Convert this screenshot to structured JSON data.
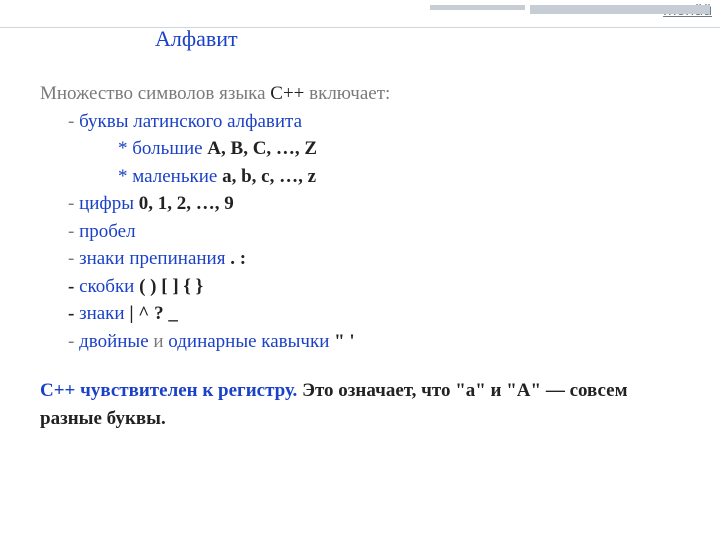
{
  "menu": "menüü",
  "title": "Алфавит",
  "intro_gray": "Множество символов языка ",
  "intro_cpp": "С++",
  "intro_after": " включает:",
  "line_latin": "буквы латинского алфавита",
  "line_big_prefix": "* большие",
  "letters_big": " A, B, C, …, Z",
  "line_small_prefix": "* маленькие",
  "letters_small": " a, b, c, …, z",
  "line_digits": "цифры",
  "digits": " 0, 1, 2, …, 9",
  "line_space": "пробел",
  "line_punct": "знаки препинания",
  "punct": "  .   :",
  "line_brackets": "скобки",
  "brackets": " (   )   [   ]   {   }",
  "line_signs": "знаки",
  "signs": "  |   ^   ?   _",
  "line_quotes_1": "двойные",
  "line_quotes_and": " и ",
  "line_quotes_2": "одинарные кавычки",
  "quotes": "  \"    '",
  "note_1": "C++ чувствителен к регистру.",
  "note_2": " Это означает, что \"a\" и \"A\" — совсем разные буквы."
}
